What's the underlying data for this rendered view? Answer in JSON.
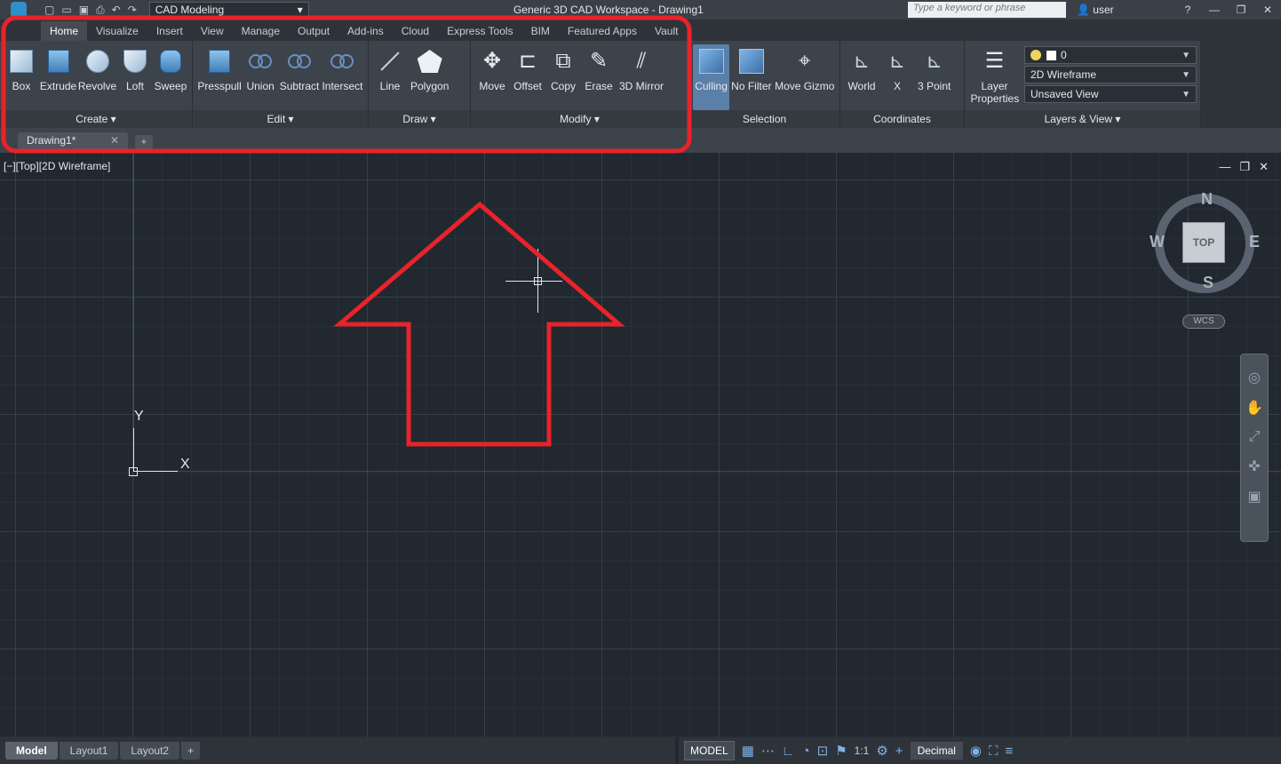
{
  "titlebar": {
    "workspace": "CAD Modeling",
    "title": "Generic 3D CAD Workspace - Drawing1",
    "search_placeholder": "Type a keyword or phrase",
    "user": "user"
  },
  "tabs": [
    "Home",
    "Visualize",
    "Insert",
    "View",
    "Manage",
    "Output",
    "Add-ins",
    "Cloud",
    "Express Tools",
    "BIM",
    "Featured Apps",
    "Vault"
  ],
  "ribbon": {
    "create": {
      "title": "Create",
      "tools": [
        "Box",
        "Extrude",
        "Revolve",
        "Loft",
        "Sweep"
      ]
    },
    "edit": {
      "title": "Edit",
      "tools": [
        "Presspull",
        "Union",
        "Subtract",
        "Intersect"
      ]
    },
    "draw": {
      "title": "Draw",
      "tools": [
        "Line",
        "Polygon"
      ]
    },
    "modify": {
      "title": "Modify",
      "tools": [
        "Move",
        "Offset",
        "Copy",
        "Erase",
        "3D Mirror"
      ]
    },
    "selection": {
      "title": "Selection",
      "tools": [
        "Culling",
        "No Filter",
        "Move Gizmo"
      ]
    },
    "coordinates": {
      "title": "Coordinates",
      "tools": [
        "World",
        "X",
        "3 Point"
      ]
    },
    "layers": {
      "title": "Layers & View",
      "tool": "Layer Properties",
      "layer": "0",
      "visual_style": "2D Wireframe",
      "view": "Unsaved View"
    }
  },
  "file_tab": "Drawing1*",
  "viewport": {
    "label": "[−][Top][2D Wireframe]",
    "ucs_x": "X",
    "ucs_y": "Y",
    "compass": {
      "n": "N",
      "s": "S",
      "e": "E",
      "w": "W",
      "cube": "TOP",
      "wcs": "WCS"
    }
  },
  "layout_tabs": [
    "Model",
    "Layout1",
    "Layout2"
  ],
  "status": {
    "space": "MODEL",
    "scale": "1:1",
    "units": "Decimal"
  },
  "colors": {
    "highlight": "#e8232a",
    "accent": "#2f8fc9"
  }
}
